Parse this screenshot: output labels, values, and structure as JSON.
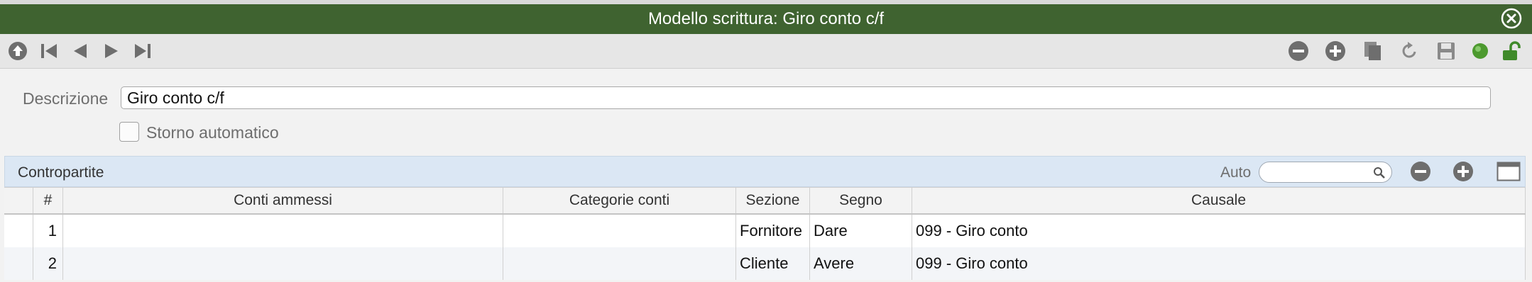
{
  "window": {
    "title": "Modello scrittura: Giro conto c/f"
  },
  "form": {
    "descrizione_label": "Descrizione",
    "descrizione_value": "Giro conto c/f",
    "storno_label": "Storno automatico"
  },
  "panel": {
    "title": "Contropartite",
    "auto_label": "Auto"
  },
  "table": {
    "headers": [
      "",
      "#",
      "Conti ammessi",
      "Categorie conti",
      "Sezione",
      "Segno",
      "Causale"
    ],
    "rows": [
      {
        "num": "1",
        "conti": "",
        "categorie": "",
        "sezione": "Fornitore",
        "segno": "Dare",
        "causale": "099 - Giro conto"
      },
      {
        "num": "2",
        "conti": "",
        "categorie": "",
        "sezione": "Cliente",
        "segno": "Avere",
        "causale": "099 - Giro conto"
      }
    ]
  },
  "colors": {
    "titlebar": "#3f6330",
    "panel_header": "#dbe7f4",
    "row_alt": "#f3f5f8",
    "status_green": "#4d9a2f"
  }
}
